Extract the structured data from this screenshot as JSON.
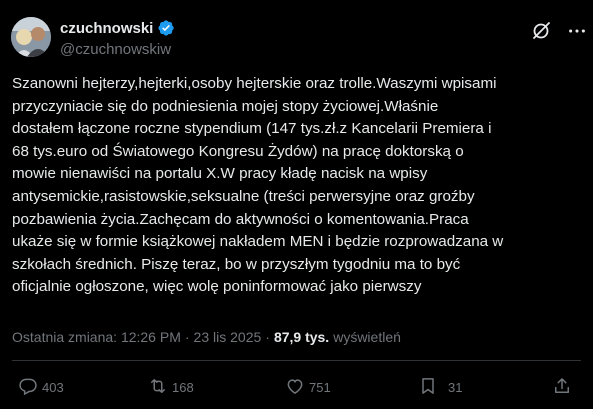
{
  "author": {
    "display_name": "czuchnowski",
    "handle": "@czuchnowskiw",
    "verified": true
  },
  "post": {
    "text": "Szanowni hejterzy,hejterki,osoby hejterskie oraz trolle.Waszymi wpisami\nprzyczyniacie się do podniesienia mojej stopy życiowej.Właśnie\ndostałem łączone roczne stypendium  (147 tys.zł.z Kancelarii Premiera i\n68 tys.euro od Światowego Kongresu Żydów) na pracę doktorską o\nmowie nienawiści na portalu X.W pracy kładę nacisk na wpisy\nantysemickie,rasistowskie,seksualne (treści perwersyjne oraz groźby\npozbawienia życia.Zachęcam do aktywności o komentowania.Praca\nukaże się w formie książkowej nakładem MEN i będzie rozprowadzana w\nszkołach średnich. Piszę teraz, bo w przyszłym tygodniu ma to być\noficjalnie ogłoszone, więc wolę poninformować jako pierwszy"
  },
  "meta": {
    "edited_label": "Ostatnia zmiana: 12:26 PM",
    "date": "23 lis 2025",
    "views_count": "87,9 tys.",
    "views_label": "wyświetleń"
  },
  "actions": {
    "replies": "403",
    "reposts": "168",
    "likes": "751",
    "bookmarks": "31"
  },
  "icons": {
    "verified": "verified-badge-icon",
    "grok": "grok-icon",
    "more": "more-icon",
    "reply": "reply-icon",
    "repost": "repost-icon",
    "like": "like-icon",
    "bookmark": "bookmark-icon",
    "share": "share-icon"
  },
  "colors": {
    "background": "#000000",
    "text": "#e7e9ea",
    "secondary_text": "#71767b",
    "verified_blue": "#1d9bf0",
    "divider": "#2f3336"
  }
}
